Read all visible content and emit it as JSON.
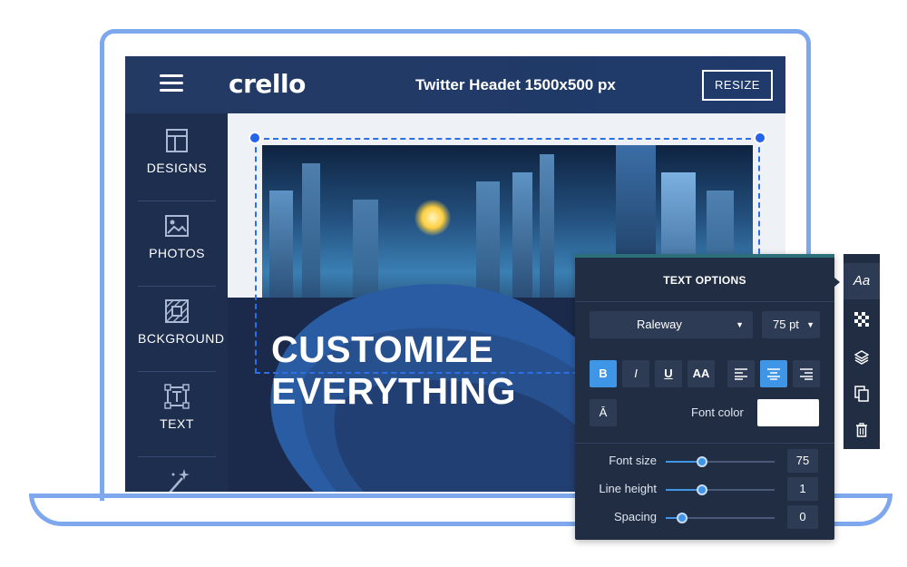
{
  "app": {
    "logo": "crello",
    "doc_title": "Twitter Headet 1500x500 px",
    "resize_label": "RESIZE"
  },
  "sidebar": {
    "items": [
      {
        "label": "DESIGNS",
        "icon": "layout-icon"
      },
      {
        "label": "PHOTOS",
        "icon": "image-icon"
      },
      {
        "label": "BCKGROUND",
        "icon": "background-pattern-icon"
      },
      {
        "label": "TEXT",
        "icon": "text-box-icon"
      },
      {
        "label": "",
        "icon": "magic-wand-icon"
      }
    ]
  },
  "canvas": {
    "headline_line1": "CUSTOMIZE",
    "headline_line2": "EVERYTHING"
  },
  "text_options": {
    "title": "TEXT OPTIONS",
    "font_family": "Raleway",
    "font_size_select": "75 pt",
    "bold_label": "B",
    "italic_label": "I",
    "underline_label": "U",
    "uppercase_label": "AA",
    "strike_label": "Ā",
    "font_color_label": "Font color",
    "font_color": "#ffffff",
    "sliders": [
      {
        "label": "Font size",
        "value": "75",
        "level": 0.33
      },
      {
        "label": "Line height",
        "value": "1",
        "level": 0.33
      },
      {
        "label": "Spacing",
        "value": "0",
        "level": 0.15
      }
    ]
  },
  "right_toolbar": {
    "text_tab_label": "Aa",
    "icons": [
      "text-style-icon",
      "transparency-icon",
      "layers-icon",
      "duplicate-icon",
      "delete-icon"
    ]
  },
  "colors": {
    "accent": "#4096e6",
    "frame": "#7ea7ee",
    "panel": "#202d43"
  }
}
